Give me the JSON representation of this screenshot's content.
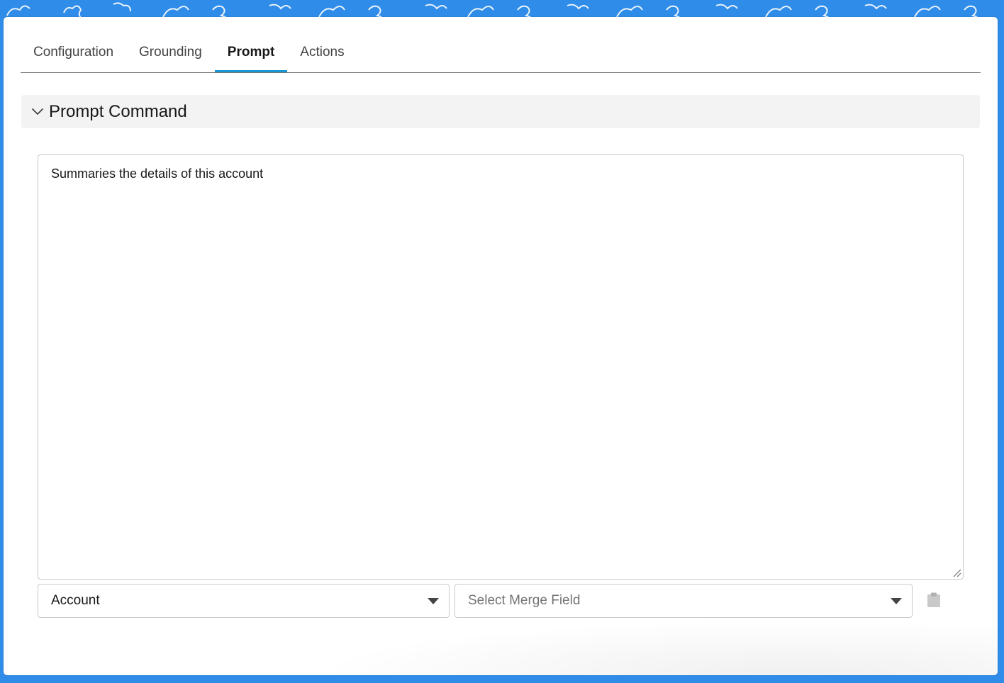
{
  "colors": {
    "background": "#2f8ce8",
    "panel": "#ffffff",
    "active_tab_indicator": "#1b96d4",
    "section_header_bg": "#f3f3f3",
    "text_primary": "#181818",
    "text_placeholder": "#747474"
  },
  "tabs": [
    {
      "label": "Configuration",
      "active": false
    },
    {
      "label": "Grounding",
      "active": false
    },
    {
      "label": "Prompt",
      "active": true
    },
    {
      "label": "Actions",
      "active": false
    }
  ],
  "section": {
    "title": "Prompt Command",
    "expanded": true,
    "icon": "chevron-down-icon"
  },
  "prompt_textarea": {
    "value": "Summaries the details of this account"
  },
  "object_select": {
    "value": "Account"
  },
  "merge_field_select": {
    "placeholder": "Select Merge Field"
  },
  "icons": {
    "clipboard": "clipboard-icon",
    "caret": "caret-down-icon",
    "resize": "resize-handle-icon"
  }
}
